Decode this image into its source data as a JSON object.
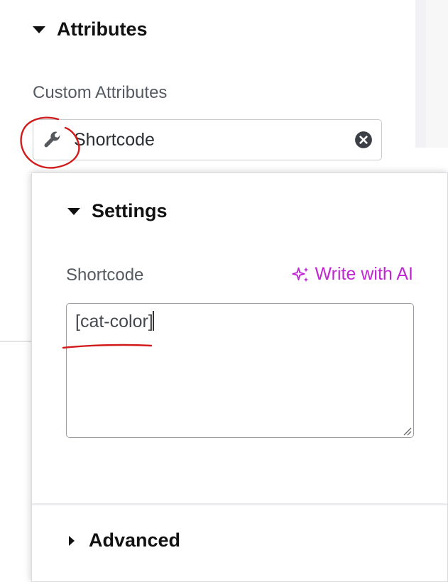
{
  "attributes_section": {
    "title": "Attributes",
    "custom_attributes_label": "Custom Attributes",
    "field_value": "Shortcode",
    "field_icon": "wrench-icon",
    "clear_icon": "clear-circle-icon"
  },
  "popover": {
    "settings_title": "Settings",
    "shortcode_label": "Shortcode",
    "write_ai_label": "Write with AI",
    "shortcode_value": "[cat-color]",
    "advanced_title": "Advanced"
  },
  "colors": {
    "accent": "#c026d3",
    "annotation": "#d11a1a"
  }
}
